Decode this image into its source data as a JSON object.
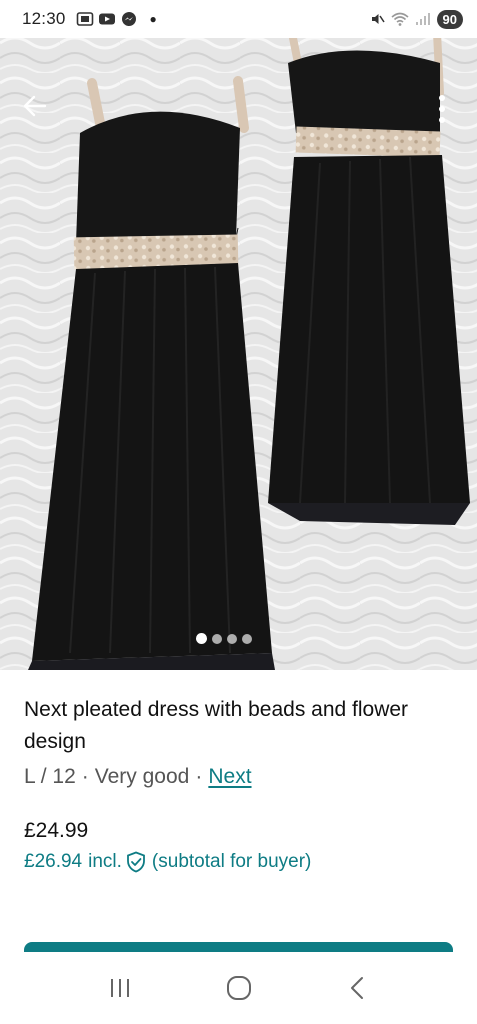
{
  "status_bar": {
    "time": "12:30",
    "battery": "90",
    "icons_left": [
      "screenshot-icon",
      "youtube-icon",
      "messenger-icon"
    ],
    "icons_right": [
      "mute-icon",
      "wifi-icon",
      "signal-icon"
    ]
  },
  "gallery": {
    "image_count": 4,
    "active_index": 0
  },
  "item": {
    "title": "Next pleated dress with beads and flower design",
    "size": "L / 12",
    "separator": "·",
    "condition": "Very good",
    "brand": "Next",
    "price": "£24.99",
    "price_incl": "£26.94",
    "incl_label": "incl.",
    "incl_note": "(subtotal for buyer)"
  },
  "colors": {
    "accent": "#0e7c84",
    "text": "#111111",
    "muted": "#555555"
  }
}
